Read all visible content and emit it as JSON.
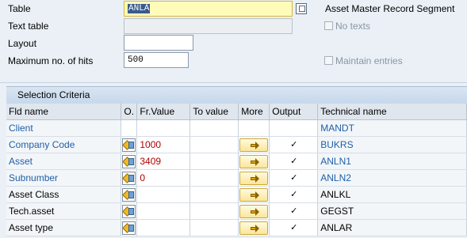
{
  "header": {
    "table_label": "Table",
    "table_value": "ANLA",
    "table_description": "Asset Master Record Segment",
    "text_table_label": "Text table",
    "text_table_value": "",
    "no_texts_label": "No texts",
    "layout_label": "Layout",
    "layout_value": "",
    "max_hits_label": "Maximum no. of hits",
    "max_hits_value": "500",
    "maintain_entries_label": "Maintain entries"
  },
  "selection": {
    "title": "Selection Criteria",
    "columns": [
      "Fld name",
      "O.",
      "Fr.Value",
      "To value",
      "More",
      "Output",
      "Technical name"
    ],
    "rows": [
      {
        "name": "Client",
        "has_controls": false,
        "from": "",
        "to": "",
        "output": "",
        "tech": "MANDT",
        "link": true
      },
      {
        "name": "Company Code",
        "has_controls": true,
        "from": "1000",
        "to": "",
        "output": "✓",
        "tech": "BUKRS",
        "link": true
      },
      {
        "name": "Asset",
        "has_controls": true,
        "from": "3409",
        "to": "",
        "output": "✓",
        "tech": "ANLN1",
        "link": true
      },
      {
        "name": "Subnumber",
        "has_controls": true,
        "from": "0",
        "to": "",
        "output": "✓",
        "tech": "ANLN2",
        "link": true
      },
      {
        "name": "Asset Class",
        "has_controls": true,
        "from": "",
        "to": "",
        "output": "✓",
        "tech": "ANLKL",
        "link": false
      },
      {
        "name": "Tech.asset",
        "has_controls": true,
        "from": "",
        "to": "",
        "output": "✓",
        "tech": "GEGST",
        "link": false
      },
      {
        "name": "Asset type",
        "has_controls": true,
        "from": "",
        "to": "",
        "output": "✓",
        "tech": "ANLAR",
        "link": false
      }
    ]
  },
  "colors": {
    "background": "#eaf0f6",
    "link": "#1f5fa8",
    "value": "#b00000"
  }
}
